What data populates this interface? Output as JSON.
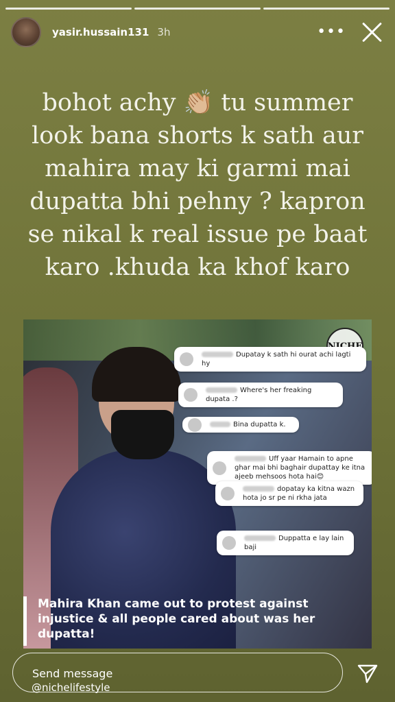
{
  "story": {
    "username": "yasir.hussain131",
    "time": "3h",
    "more_label": "•••",
    "progress_count": 3
  },
  "caption": {
    "text": "bohot achy 👏🏼 tu summer look bana shorts k sath aur mahira may ki garmi mai dupatta bhi pehny ? kapron se nikal k real issue pe baat karo .khuda ka khof karo"
  },
  "post": {
    "logo": "NICHE",
    "comments": [
      {
        "text": "Dupatay k sath hi ourat achi lagti hy"
      },
      {
        "text": "Where's her freaking dupata .?"
      },
      {
        "text": "Bina dupatta k."
      },
      {
        "text": "Uff yaar Hamain to apne ghar mai bhi baghair dupattay ke itna ajeeb mehsoos hota hai😊"
      },
      {
        "text": "dopatay ka kitna wazn hota jo sr pe ni rkha jata"
      },
      {
        "text": "Duppatta e lay lain baji"
      }
    ],
    "banner": "Mahira Khan came out to protest against injustice & all people cared about was her dupatta!"
  },
  "footer": {
    "send_placeholder": "Send message",
    "mention": "@nichelifestyle"
  },
  "icons": {
    "avatar": "avatar-icon",
    "more": "more-icon",
    "close": "close-icon",
    "send": "send-icon"
  }
}
